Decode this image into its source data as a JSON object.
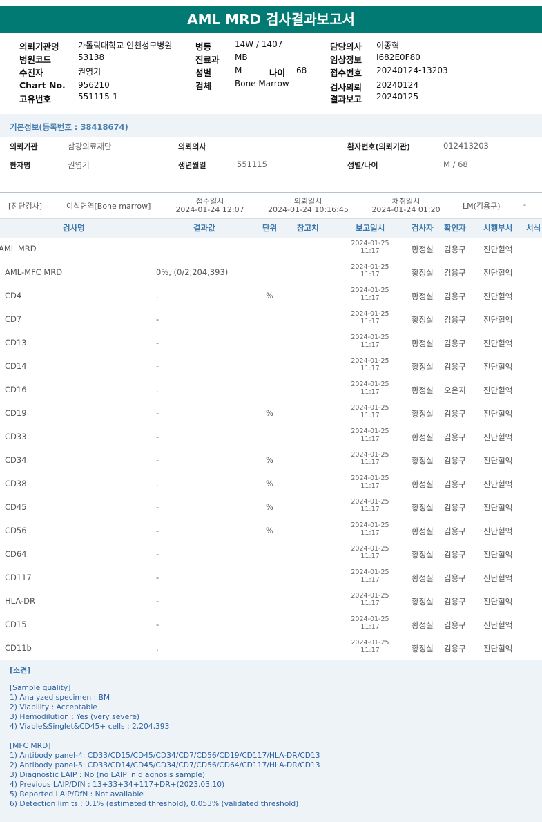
{
  "title": "AML MRD 검사결과보고서",
  "header": {
    "col1": [
      {
        "label": "의뢰기관명",
        "value": "가톨릭대학교 인천성모병원"
      },
      {
        "label": "병원코드",
        "value": "53138"
      },
      {
        "label": "수진자",
        "value": "권영기"
      },
      {
        "label": "Chart No.",
        "value": "956210"
      },
      {
        "label": "고유번호",
        "value": "551115-1"
      }
    ],
    "col2": [
      {
        "label": "병동",
        "value": "14W / 1407"
      },
      {
        "label": "진료과",
        "value": "MB"
      },
      {
        "label": "성별",
        "value": "M"
      },
      {
        "label": "검체",
        "value": "Bone Marrow"
      }
    ],
    "age": {
      "label": "나이",
      "value": "68"
    },
    "col3": [
      {
        "label": "담당의사",
        "value": "이종혁"
      },
      {
        "label": "임상정보",
        "value": "I682E0F80"
      },
      {
        "label": "접수번호",
        "value": "20240124-13203"
      },
      {
        "label": "검사의뢰",
        "value": "20240124"
      },
      {
        "label": "결과보고",
        "value": "20240125"
      }
    ]
  },
  "basic_info": {
    "title": "기본정보(등록번호 : 38418674)",
    "fields": [
      {
        "label": "의뢰기관",
        "value": "삼광의료재단"
      },
      {
        "label": "의뢰의사",
        "value": ""
      },
      {
        "label": "환자번호(의뢰기관)",
        "value": "012413203"
      },
      {
        "label": "환자명",
        "value": "권영기"
      },
      {
        "label": "생년월일",
        "value": "551115"
      },
      {
        "label": "성별/나이",
        "value": "M / 68"
      }
    ]
  },
  "order": {
    "category": "[진단검사]",
    "test": "이식면역[Bone marrow]",
    "received_label": "접수일시",
    "received": "2024-01-24 12:07",
    "requested_label": "의뢰일시",
    "requested": "2024-01-24 10:16:45",
    "collected_label": "채취일시",
    "collected": "2024-01-24 01:20",
    "doctor": "LM(김용구)",
    "extra": "-"
  },
  "table": {
    "headers": [
      "검사명",
      "결과값",
      "단위",
      "참고치",
      "보고일시",
      "검사자",
      "확인자",
      "시행부서",
      "서식"
    ],
    "rows": [
      {
        "name": "AML MRD",
        "result": "",
        "unit": "",
        "date": "2024-01-25",
        "time": "11:17",
        "tester": "황정실",
        "confirmer": "김용구",
        "dept": "진단혈액"
      },
      {
        "name": "AML-MFC MRD",
        "result": "0%, (0/2,204,393)",
        "unit": "",
        "date": "2024-01-25",
        "time": "11:17",
        "tester": "황정실",
        "confirmer": "김용구",
        "dept": "진단혈액"
      },
      {
        "name": "CD4",
        "result": ".",
        "unit": "%",
        "date": "2024-01-25",
        "time": "11:17",
        "tester": "황정실",
        "confirmer": "김용구",
        "dept": "진단혈액"
      },
      {
        "name": "CD7",
        "result": "-",
        "unit": "",
        "date": "2024-01-25",
        "time": "11:17",
        "tester": "황정실",
        "confirmer": "김용구",
        "dept": "진단혈액"
      },
      {
        "name": "CD13",
        "result": "-",
        "unit": "",
        "date": "2024-01-25",
        "time": "11:17",
        "tester": "황정실",
        "confirmer": "김용구",
        "dept": "진단혈액"
      },
      {
        "name": "CD14",
        "result": "-",
        "unit": "",
        "date": "2024-01-25",
        "time": "11:17",
        "tester": "황정실",
        "confirmer": "김용구",
        "dept": "진단혈액"
      },
      {
        "name": "CD16",
        "result": ".",
        "unit": "",
        "date": "2024-01-25",
        "time": "11:17",
        "tester": "황정실",
        "confirmer": "오은지",
        "dept": "진단혈액"
      },
      {
        "name": "CD19",
        "result": "-",
        "unit": "%",
        "date": "2024-01-25",
        "time": "11:17",
        "tester": "황정실",
        "confirmer": "김용구",
        "dept": "진단혈액"
      },
      {
        "name": "CD33",
        "result": "-",
        "unit": "",
        "date": "2024-01-25",
        "time": "11:17",
        "tester": "황정실",
        "confirmer": "김용구",
        "dept": "진단혈액"
      },
      {
        "name": "CD34",
        "result": "-",
        "unit": "%",
        "date": "2024-01-25",
        "time": "11:17",
        "tester": "황정실",
        "confirmer": "김용구",
        "dept": "진단혈액"
      },
      {
        "name": "CD38",
        "result": ".",
        "unit": "%",
        "date": "2024-01-25",
        "time": "11:17",
        "tester": "황정실",
        "confirmer": "김용구",
        "dept": "진단혈액"
      },
      {
        "name": "CD45",
        "result": "-",
        "unit": "%",
        "date": "2024-01-25",
        "time": "11:17",
        "tester": "황정실",
        "confirmer": "김용구",
        "dept": "진단혈액"
      },
      {
        "name": "CD56",
        "result": "-",
        "unit": "%",
        "date": "2024-01-25",
        "time": "11:17",
        "tester": "황정실",
        "confirmer": "김용구",
        "dept": "진단혈액"
      },
      {
        "name": "CD64",
        "result": "-",
        "unit": "",
        "date": "2024-01-25",
        "time": "11:17",
        "tester": "황정실",
        "confirmer": "김용구",
        "dept": "진단혈액"
      },
      {
        "name": "CD117",
        "result": "-",
        "unit": "",
        "date": "2024-01-25",
        "time": "11:17",
        "tester": "황정실",
        "confirmer": "김용구",
        "dept": "진단혈액"
      },
      {
        "name": "HLA-DR",
        "result": "-",
        "unit": "",
        "date": "2024-01-25",
        "time": "11:17",
        "tester": "황정실",
        "confirmer": "김용구",
        "dept": "진단혈액"
      },
      {
        "name": "CD15",
        "result": "-",
        "unit": "",
        "date": "2024-01-25",
        "time": "11:17",
        "tester": "황정실",
        "confirmer": "김용구",
        "dept": "진단혈액"
      },
      {
        "name": "CD11b",
        "result": ".",
        "unit": "",
        "date": "2024-01-25",
        "time": "11:17",
        "tester": "황정실",
        "confirmer": "김용구",
        "dept": "진단혈액"
      }
    ]
  },
  "findings": {
    "title": "[소견]",
    "text": "[Sample quality]\n1) Analyzed specimen : BM\n2) Viability : Acceptable\n3) Hemodilution : Yes (very severe)\n4) Viable&Singlet&CD45+ cells : 2,204,393\n\n[MFC MRD]\n1) Antibody panel-4: CD33/CD15/CD45/CD34/CD7/CD56/CD19/CD117/HLA-DR/CD13\n2) Antibody panel-5: CD33/CD14/CD45/CD34/CD7/CD56/CD64/CD117/HLA-DR/CD13\n3) Diagnostic LAIP : No (no LAIP in diagnosis sample)\n4) Previous LAIP/DfN : 13+33+34+117+DR+(2023.03.10)\n5) Reported LAIP/DfN : Not available\n6) Detection limits : 0.1% (estimated threshold), 0.053% (validated threshold)"
  },
  "colors": {
    "title_bg": "#007a72",
    "accent_blue": "#3d78ab",
    "findings_text": "#2c5fa0",
    "section_bg": "#eef3f7"
  }
}
